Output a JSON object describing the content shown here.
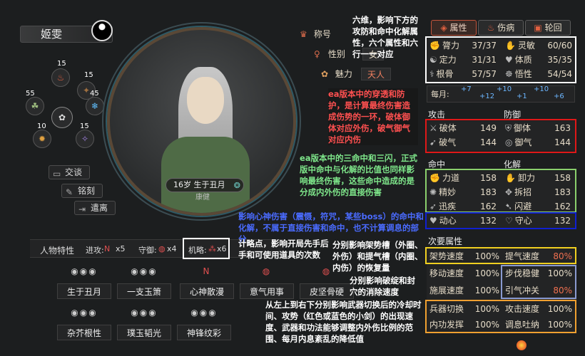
{
  "character": {
    "name": "姬雯",
    "age_bar": "16岁  生于丑月",
    "health": "康健"
  },
  "wheel": {
    "values": [
      "15",
      "15",
      "55",
      "45",
      "10",
      "15"
    ]
  },
  "side_buttons": [
    {
      "label": "交谈",
      "icon": "chat-icon"
    },
    {
      "label": "铭刻",
      "icon": "carve-icon"
    },
    {
      "label": "遣离",
      "icon": "dismiss-icon"
    }
  ],
  "attributes": {
    "title_label": "称号",
    "gender_label": "性别",
    "gender_value": "女",
    "charm_label": "魅力",
    "charm_value": "天人"
  },
  "traits_bar": {
    "label": "人物特性",
    "attack": "进攻:",
    "attack_count": "x5",
    "defense": "守御:",
    "defense_count": "x4",
    "strategy": "机略:",
    "strategy_count": "x6"
  },
  "traits": [
    {
      "name": "生于丑月",
      "icons": "◉◉◉"
    },
    {
      "name": "一支玉箫",
      "icons": "◉◉◉"
    },
    {
      "name": "心神散漫",
      "icons": "N"
    },
    {
      "name": "意气用事",
      "icons": "◍"
    },
    {
      "name": "皮坚骨硬",
      "icons": "◍"
    },
    {
      "name": "杂芥根性",
      "icons": "◉◉◉"
    },
    {
      "name": "璞玉韬光",
      "icons": "◉◉◉"
    },
    {
      "name": "神锋纹彩",
      "icons": "◉◉◉"
    }
  ],
  "tabs": [
    {
      "label": "属性",
      "active": true
    },
    {
      "label": "伤病",
      "active": false
    },
    {
      "label": "轮回",
      "active": false
    }
  ],
  "six_stats": [
    {
      "label": "膂力",
      "value": "37/37"
    },
    {
      "label": "灵敏",
      "value": "60/60"
    },
    {
      "label": "定力",
      "value": "31/31"
    },
    {
      "label": "体质",
      "value": "35/35"
    },
    {
      "label": "根骨",
      "value": "57/57"
    },
    {
      "label": "悟性",
      "value": "54/54"
    }
  ],
  "monthly": {
    "label": "每月:",
    "values": [
      "+7",
      "+12",
      "+10",
      "+1",
      "+10",
      "+6"
    ]
  },
  "attack_defense": {
    "attack_head": "攻击",
    "defense_head": "防御",
    "rows": [
      {
        "a_label": "破体",
        "a_val": "149",
        "d_label": "御体",
        "d_val": "163"
      },
      {
        "a_label": "破气",
        "a_val": "144",
        "d_label": "御气",
        "d_val": "144"
      }
    ]
  },
  "hit_resolve": {
    "hit_head": "命中",
    "resolve_head": "化解",
    "rows": [
      {
        "a_label": "力道",
        "a_val": "158",
        "d_label": "卸力",
        "d_val": "158"
      },
      {
        "a_label": "精妙",
        "a_val": "183",
        "d_label": "拆招",
        "d_val": "183"
      },
      {
        "a_label": "迅疾",
        "a_val": "162",
        "d_label": "闪避",
        "d_val": "162"
      },
      {
        "a_label": "动心",
        "a_val": "132",
        "d_label": "守心",
        "d_val": "132"
      }
    ]
  },
  "secondary": {
    "head": "次要属性",
    "rows": [
      {
        "a_label": "架势速度",
        "a_val": "100%",
        "d_label": "提气速度",
        "d_val": "80%"
      },
      {
        "a_label": "移动速度",
        "a_val": "100%",
        "d_label": "步伐稳健",
        "d_val": "100%"
      },
      {
        "a_label": "施展速度",
        "a_val": "100%",
        "d_label": "引气冲关",
        "d_val": "80%"
      },
      {
        "a_label": "兵器切换",
        "a_val": "100%",
        "d_label": "攻击速度",
        "d_val": "100%"
      },
      {
        "a_label": "内功发挥",
        "a_val": "100%",
        "d_label": "调息吐纳",
        "d_val": "100%"
      }
    ]
  },
  "annotations": {
    "six_dims": "六维，影响下方的攻防和命中化解属性，六个属性和六行一一对应",
    "ea_pierce": "ea版本中的穿透和防护，是计算最终伤害造成伤势的一环，破体御体对应外伤，破气御气对应内伤",
    "ea_hit": "ea版本中的三命中和三闪，正式版中命中与化解的比值也同样影响最终伤害，这些命中造成的是分成内外伤的直接伤害",
    "move_heart": "影响心神伤害（震慑，符咒，某些boss）的命中和化解，不属于直接伤害和命中，也不计算调息的部分",
    "strategy": "计略点，影响开局先手后手和可使用道具的次数",
    "stance": "分别影响架势槽（外圈、外伤）和提气槽（内圈、内伤）的恢复量",
    "vital": "分别影响破绽和封穴的消除速度",
    "weapon": "从左上到右下分别影响武器切换后的冷却时间、攻势（红色或蓝色的小剑）的出现速度、武器和功法能够调整内外伤比例的范围、每月内息紊乱的降低值"
  }
}
